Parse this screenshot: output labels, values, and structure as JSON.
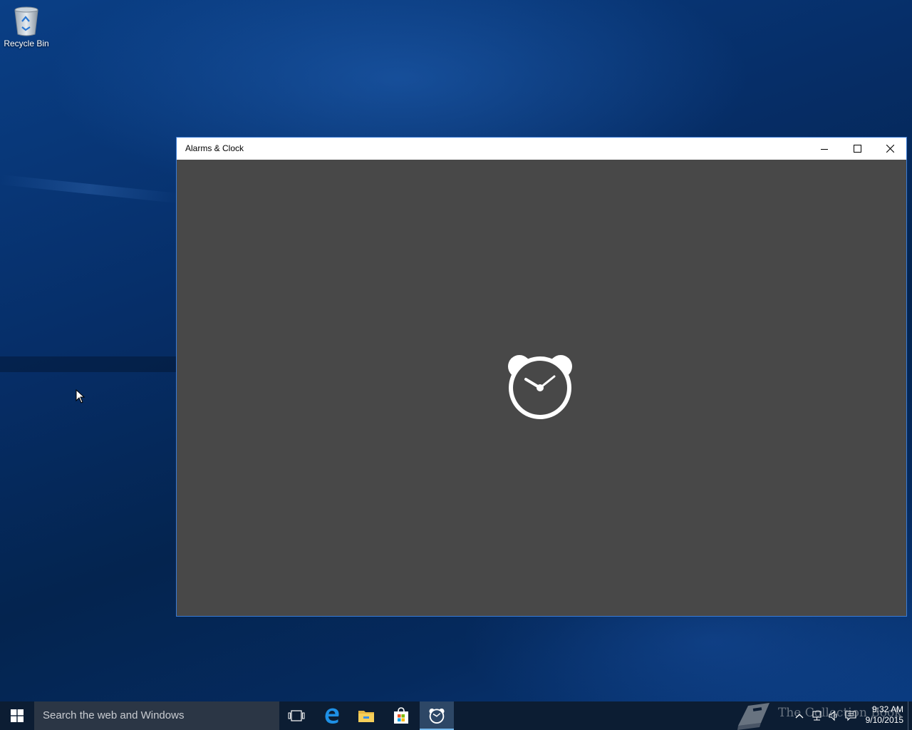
{
  "desktop": {
    "icons": [
      {
        "label": "Recycle Bin",
        "icon": "recycle-bin-icon"
      }
    ]
  },
  "window": {
    "title": "Alarms & Clock",
    "controls": {
      "minimize": "minimize-icon",
      "maximize": "maximize-icon",
      "close": "close-icon"
    },
    "splash_icon": "alarm-clock-icon",
    "background_color": "#484848"
  },
  "taskbar": {
    "search": {
      "placeholder": "Search the web and Windows"
    },
    "pinned": [
      {
        "name": "Task View",
        "icon": "task-view-icon"
      },
      {
        "name": "Microsoft Edge",
        "icon": "edge-icon"
      },
      {
        "name": "File Explorer",
        "icon": "folder-icon"
      },
      {
        "name": "Store",
        "icon": "store-icon"
      },
      {
        "name": "Alarms & Clock",
        "icon": "alarm-clock-icon",
        "active": true
      }
    ],
    "watermark": "The Collection Book",
    "tray_icons": [
      "chevron-up-icon",
      "network-icon",
      "volume-icon",
      "action-center-icon"
    ],
    "clock": {
      "time": "9:32 AM",
      "date": "9/10/2015"
    },
    "accent_color": "#76b9ed"
  }
}
